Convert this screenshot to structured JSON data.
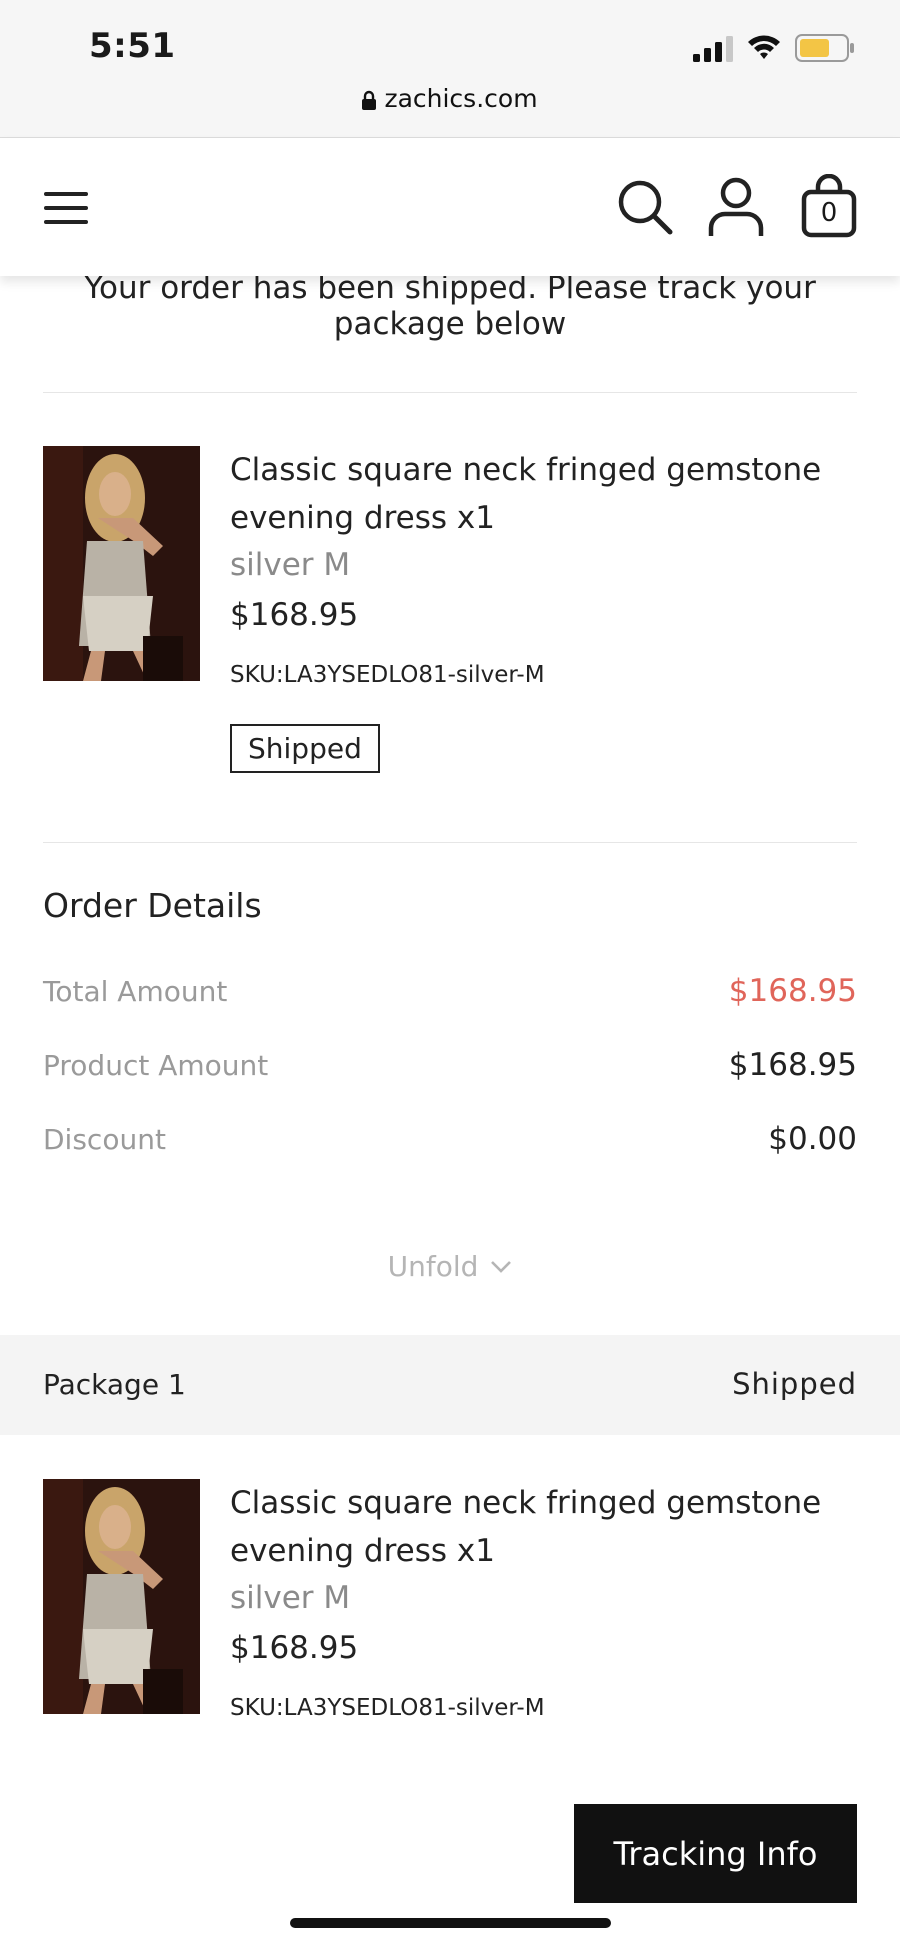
{
  "status_bar": {
    "time": "5:51",
    "url": "zachics.com"
  },
  "header": {
    "cart_count": "0"
  },
  "notice": "Your order has been shipped. Please track your package below",
  "item": {
    "title": "Classic square neck fringed gemstone evening dress x1",
    "variant": "silver M",
    "price": "$168.95",
    "sku": "SKU:LA3YSEDLO81-silver-M",
    "status": "Shipped"
  },
  "order_details": {
    "title": "Order Details",
    "rows": [
      {
        "label": "Total Amount",
        "value": "$168.95"
      },
      {
        "label": "Product Amount",
        "value": "$168.95"
      },
      {
        "label": "Discount",
        "value": "$0.00"
      }
    ],
    "unfold_label": "Unfold"
  },
  "package": {
    "name": "Package 1",
    "status": "Shipped",
    "item": {
      "title": "Classic square neck fringed gemstone evening dress x1",
      "variant": "silver M",
      "price": "$168.95",
      "sku": "SKU:LA3YSEDLO81-silver-M"
    }
  },
  "tracking_button": "Tracking Info",
  "colors": {
    "accent_red": "#e0655a",
    "button_bg": "#111111",
    "package_bar_bg": "#f4f4f4"
  }
}
